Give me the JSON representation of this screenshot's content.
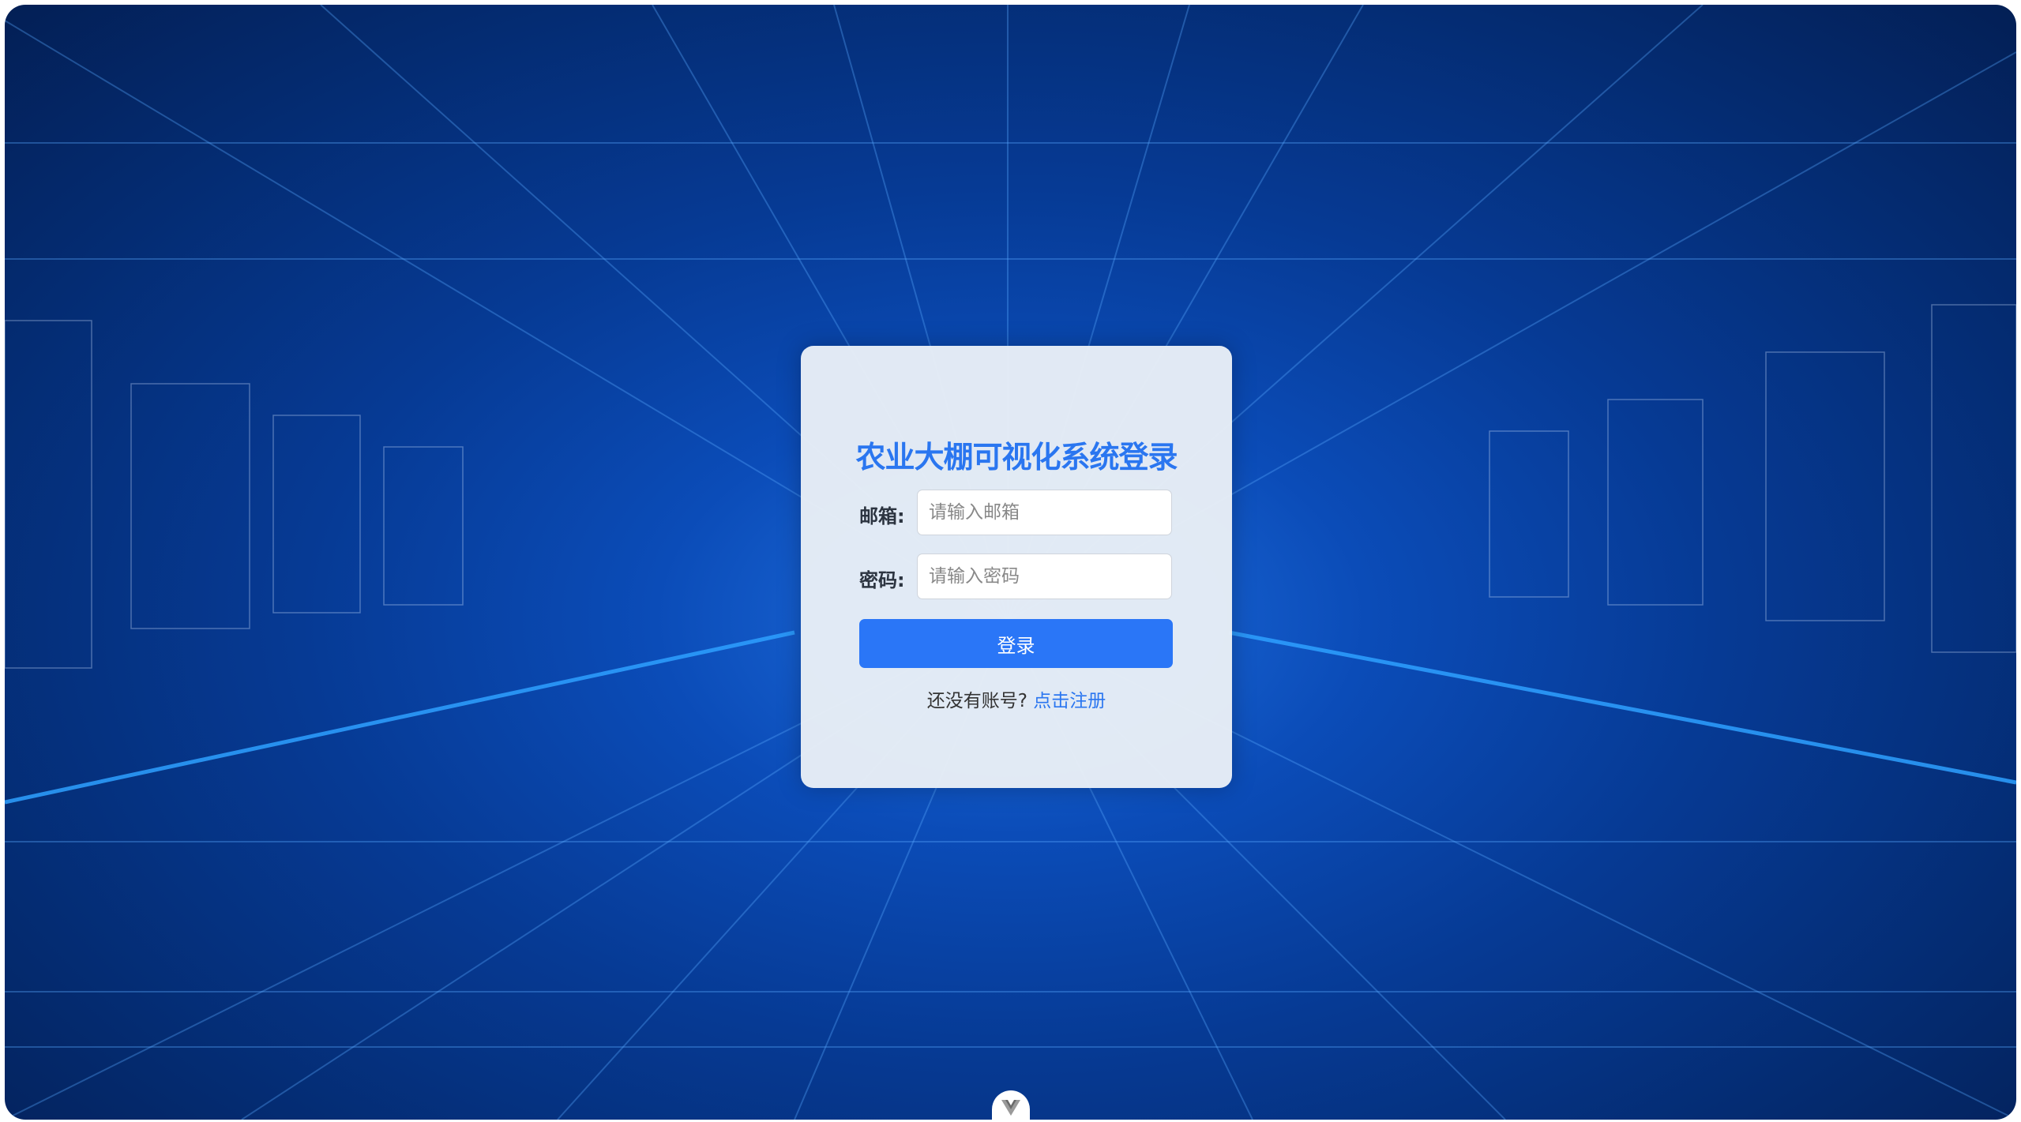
{
  "login": {
    "title": "农业大棚可视化系统登录",
    "email_label": "邮箱:",
    "email_placeholder": "请输入邮箱",
    "email_value": "",
    "password_label": "密码:",
    "password_placeholder": "请输入密码",
    "password_value": "",
    "submit_label": "登录",
    "register_prompt": "还没有账号?",
    "register_link": "点击注册"
  },
  "colors": {
    "accent": "#2a76f7",
    "background": "#063a94"
  },
  "devtools_icon": "vue-logo-icon"
}
